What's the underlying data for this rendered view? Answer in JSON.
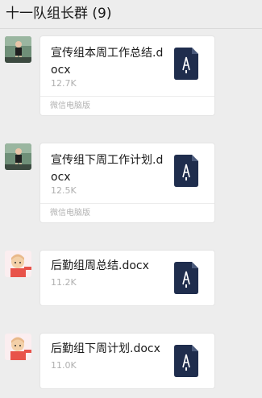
{
  "chat": {
    "title": "十一队组长群 (9)"
  },
  "messages": [
    {
      "sender": "male-avatar",
      "file_name": "宣传组本周工作总结.docx",
      "file_size": "12.7K",
      "footer": "微信电脑版",
      "icon": "word-doc-icon"
    },
    {
      "sender": "male-avatar",
      "file_name": "宣传组下周工作计划.docx",
      "file_size": "12.5K",
      "footer": "微信电脑版",
      "icon": "word-doc-icon"
    },
    {
      "sender": "female-avatar",
      "file_name": "后勤组周总结.docx",
      "file_size": "11.2K",
      "footer": "",
      "icon": "word-doc-icon"
    },
    {
      "sender": "female-avatar",
      "file_name": "后勤组下周计划.docx",
      "file_size": "11.0K",
      "footer": "",
      "icon": "word-doc-icon"
    }
  ],
  "colors": {
    "background": "#ededed",
    "card": "#ffffff",
    "doc_icon": "#1f2d4d"
  }
}
